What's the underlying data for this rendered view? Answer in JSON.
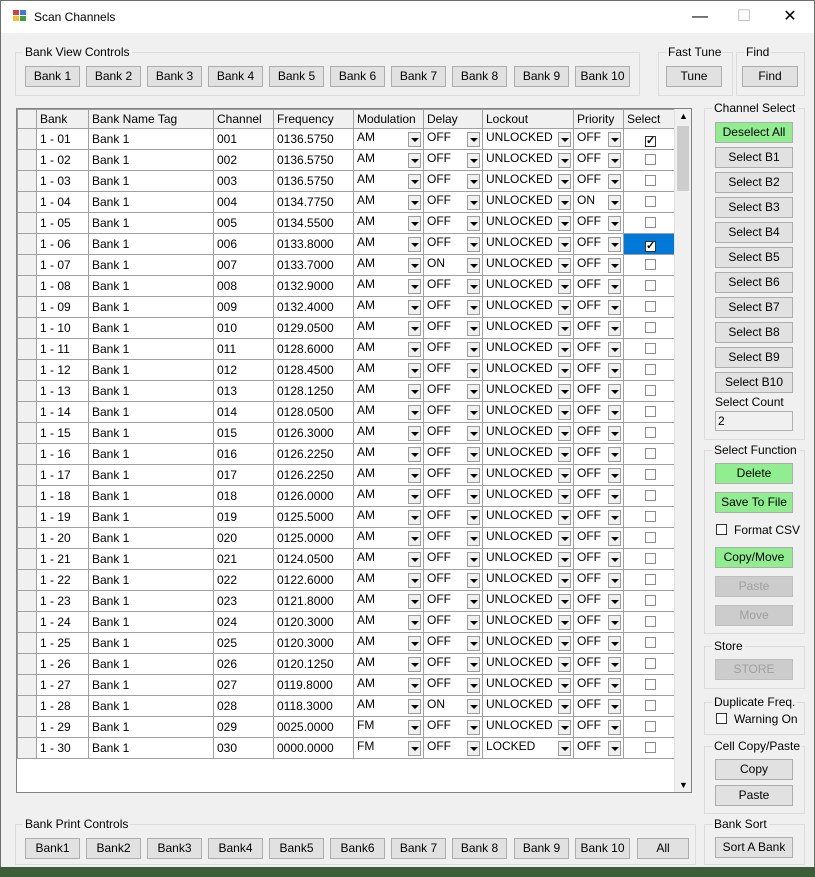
{
  "window": {
    "title": "Scan Channels",
    "minimize": "—",
    "maximize": "☐",
    "close": "✕"
  },
  "bank_view": {
    "title": "Bank View Controls",
    "buttons": [
      "Bank 1",
      "Bank 2",
      "Bank 3",
      "Bank 4",
      "Bank 5",
      "Bank 6",
      "Bank 7",
      "Bank 8",
      "Bank 9",
      "Bank 10"
    ]
  },
  "fast_tune": {
    "title": "Fast Tune",
    "button": "Tune"
  },
  "find": {
    "title": "Find",
    "button": "Find"
  },
  "grid": {
    "columns": [
      "Bank",
      "Bank Name Tag",
      "Channel",
      "Frequency",
      "Modulation",
      "Delay",
      "Lockout",
      "Priority",
      "Select"
    ],
    "rows": [
      [
        "1 - 01",
        "Bank 1",
        "001",
        "0136.5750",
        "AM",
        "OFF",
        "UNLOCKED",
        "OFF",
        true
      ],
      [
        "1 - 02",
        "Bank 1",
        "002",
        "0136.5750",
        "AM",
        "OFF",
        "UNLOCKED",
        "OFF",
        false
      ],
      [
        "1 - 03",
        "Bank 1",
        "003",
        "0136.5750",
        "AM",
        "OFF",
        "UNLOCKED",
        "OFF",
        false
      ],
      [
        "1 - 04",
        "Bank 1",
        "004",
        "0134.7750",
        "AM",
        "OFF",
        "UNLOCKED",
        "ON",
        false
      ],
      [
        "1 - 05",
        "Bank 1",
        "005",
        "0134.5500",
        "AM",
        "OFF",
        "UNLOCKED",
        "OFF",
        false
      ],
      [
        "1 - 06",
        "Bank 1",
        "006",
        "0133.8000",
        "AM",
        "OFF",
        "UNLOCKED",
        "OFF",
        true
      ],
      [
        "1 - 07",
        "Bank 1",
        "007",
        "0133.7000",
        "AM",
        "ON",
        "UNLOCKED",
        "OFF",
        false
      ],
      [
        "1 - 08",
        "Bank 1",
        "008",
        "0132.9000",
        "AM",
        "OFF",
        "UNLOCKED",
        "OFF",
        false
      ],
      [
        "1 - 09",
        "Bank 1",
        "009",
        "0132.4000",
        "AM",
        "OFF",
        "UNLOCKED",
        "OFF",
        false
      ],
      [
        "1 - 10",
        "Bank 1",
        "010",
        "0129.0500",
        "AM",
        "OFF",
        "UNLOCKED",
        "OFF",
        false
      ],
      [
        "1 - 11",
        "Bank 1",
        "011",
        "0128.6000",
        "AM",
        "OFF",
        "UNLOCKED",
        "OFF",
        false
      ],
      [
        "1 - 12",
        "Bank 1",
        "012",
        "0128.4500",
        "AM",
        "OFF",
        "UNLOCKED",
        "OFF",
        false
      ],
      [
        "1 - 13",
        "Bank 1",
        "013",
        "0128.1250",
        "AM",
        "OFF",
        "UNLOCKED",
        "OFF",
        false
      ],
      [
        "1 - 14",
        "Bank 1",
        "014",
        "0128.0500",
        "AM",
        "OFF",
        "UNLOCKED",
        "OFF",
        false
      ],
      [
        "1 - 15",
        "Bank 1",
        "015",
        "0126.3000",
        "AM",
        "OFF",
        "UNLOCKED",
        "OFF",
        false
      ],
      [
        "1 - 16",
        "Bank 1",
        "016",
        "0126.2250",
        "AM",
        "OFF",
        "UNLOCKED",
        "OFF",
        false
      ],
      [
        "1 - 17",
        "Bank 1",
        "017",
        "0126.2250",
        "AM",
        "OFF",
        "UNLOCKED",
        "OFF",
        false
      ],
      [
        "1 - 18",
        "Bank 1",
        "018",
        "0126.0000",
        "AM",
        "OFF",
        "UNLOCKED",
        "OFF",
        false
      ],
      [
        "1 - 19",
        "Bank 1",
        "019",
        "0125.5000",
        "AM",
        "OFF",
        "UNLOCKED",
        "OFF",
        false
      ],
      [
        "1 - 20",
        "Bank 1",
        "020",
        "0125.0000",
        "AM",
        "OFF",
        "UNLOCKED",
        "OFF",
        false
      ],
      [
        "1 - 21",
        "Bank 1",
        "021",
        "0124.0500",
        "AM",
        "OFF",
        "UNLOCKED",
        "OFF",
        false
      ],
      [
        "1 - 22",
        "Bank 1",
        "022",
        "0122.6000",
        "AM",
        "OFF",
        "UNLOCKED",
        "OFF",
        false
      ],
      [
        "1 - 23",
        "Bank 1",
        "023",
        "0121.8000",
        "AM",
        "OFF",
        "UNLOCKED",
        "OFF",
        false
      ],
      [
        "1 - 24",
        "Bank 1",
        "024",
        "0120.3000",
        "AM",
        "OFF",
        "UNLOCKED",
        "OFF",
        false
      ],
      [
        "1 - 25",
        "Bank 1",
        "025",
        "0120.3000",
        "AM",
        "OFF",
        "UNLOCKED",
        "OFF",
        false
      ],
      [
        "1 - 26",
        "Bank 1",
        "026",
        "0120.1250",
        "AM",
        "OFF",
        "UNLOCKED",
        "OFF",
        false
      ],
      [
        "1 - 27",
        "Bank 1",
        "027",
        "0119.8000",
        "AM",
        "OFF",
        "UNLOCKED",
        "OFF",
        false
      ],
      [
        "1 - 28",
        "Bank 1",
        "028",
        "0118.3000",
        "AM",
        "ON",
        "UNLOCKED",
        "OFF",
        false
      ],
      [
        "1 - 29",
        "Bank 1",
        "029",
        "0025.0000",
        "FM",
        "OFF",
        "UNLOCKED",
        "OFF",
        false
      ],
      [
        "1 - 30",
        "Bank 1",
        "030",
        "0000.0000",
        "FM",
        "OFF",
        "LOCKED",
        "OFF",
        false
      ]
    ]
  },
  "channel_select": {
    "title": "Channel Select",
    "buttons": [
      "Deselect All",
      "Select B1",
      "Select B2",
      "Select B3",
      "Select B4",
      "Select B5",
      "Select B6",
      "Select B7",
      "Select B8",
      "Select B9",
      "Select B10"
    ],
    "count_label": "Select Count",
    "count_value": "2"
  },
  "select_function": {
    "title": "Select Function",
    "delete": "Delete",
    "save": "Save To File",
    "format_csv": "Format CSV",
    "copy_move": "Copy/Move",
    "paste": "Paste",
    "move": "Move"
  },
  "store": {
    "title": "Store",
    "button": "STORE"
  },
  "duplicate": {
    "title": "Duplicate Freq.",
    "label": "Warning On"
  },
  "cell_copy": {
    "title": "Cell Copy/Paste",
    "copy": "Copy",
    "paste": "Paste"
  },
  "bank_print": {
    "title": "Bank Print Controls",
    "buttons": [
      "Bank1",
      "Bank2",
      "Bank3",
      "Bank4",
      "Bank5",
      "Bank6",
      "Bank 7",
      "Bank 8",
      "Bank 9",
      "Bank 10",
      "All"
    ]
  },
  "bank_sort": {
    "title": "Bank Sort",
    "button": "Sort A Bank"
  },
  "colors": {
    "green_button": "#90ee90",
    "selection": "#0078d7"
  }
}
